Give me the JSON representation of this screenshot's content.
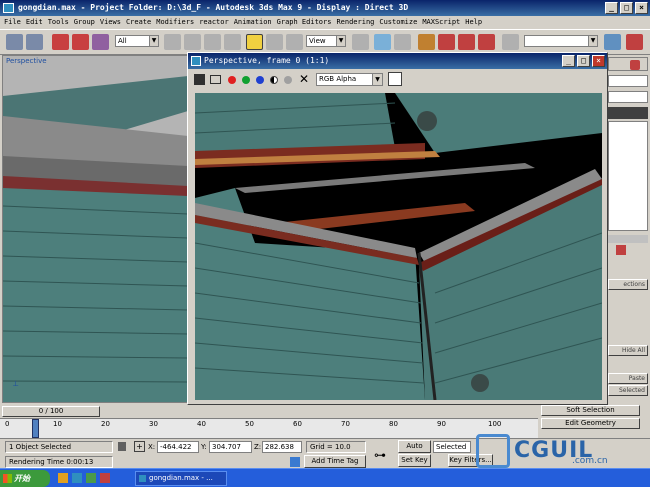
{
  "window": {
    "title": "gongdian.max    - Project Folder: D:\\3d_F     - Autodesk 3ds Max 9     - Display : Direct 3D",
    "minimize": "_",
    "maximize": "□",
    "close": "×"
  },
  "menu": [
    "File",
    "Edit",
    "Tools",
    "Group",
    "Views",
    "Create",
    "Modifiers",
    "reactor",
    "Animation",
    "Graph Editors",
    "Rendering",
    "Customize",
    "MAXScript",
    "Help"
  ],
  "toolbar": {
    "selection_filter": "All",
    "ref_coord": "View",
    "icons": [
      "undo-icon",
      "redo-icon",
      "link-icon",
      "unlink-icon",
      "bind-space-warp-icon",
      "select-icon",
      "select-by-name-icon",
      "region-select-icon",
      "window-crossing-icon",
      "move-icon",
      "rotate-icon",
      "scale-icon",
      "pivot-icon",
      "mirror-icon",
      "align-icon",
      "snap-icon",
      "angle-snap-icon",
      "percent-snap-icon",
      "spinner-snap-icon",
      "named-selection-icon",
      "render-icon"
    ]
  },
  "viewport": {
    "label": "Perspective"
  },
  "frame_window": {
    "title": "Perspective, frame 0 (1:1)",
    "channel": "RGB Alpha",
    "close": "×"
  },
  "command_panel": {
    "items": [
      "ections",
      "Hide All",
      "Paste",
      "Selected"
    ]
  },
  "timeline": {
    "current": "0 / 100",
    "ticks": [
      "0",
      "10",
      "20",
      "30",
      "40",
      "50",
      "60",
      "70",
      "80",
      "90",
      "100"
    ]
  },
  "status": {
    "selection": "1 Object Selected",
    "render_time": "Rendering Time  0:00:13",
    "x_label": "X:",
    "x": "-464.422",
    "y_label": "Y:",
    "y": "304.707",
    "z_label": "Z:",
    "z": "282.638",
    "grid": "Grid = 10.0",
    "add_time_tag": "Add Time Tag",
    "auto_key": "Auto Key",
    "set_key": "Set Key",
    "selected": "Selected",
    "key_filters": "Key Filters...",
    "soft_selection": "Soft Selection",
    "edit_geometry": "Edit Geometry"
  },
  "taskbar": {
    "start": "开始",
    "item": "gongdian.max - ..."
  },
  "watermark": {
    "text": "CGUIL",
    "sub": ".com.cn"
  },
  "colors": {
    "title_bar": "#0a246a",
    "roof_tile": "#4d7f7c",
    "ridge": "#a9a9a9",
    "render_bg": "#000000"
  }
}
